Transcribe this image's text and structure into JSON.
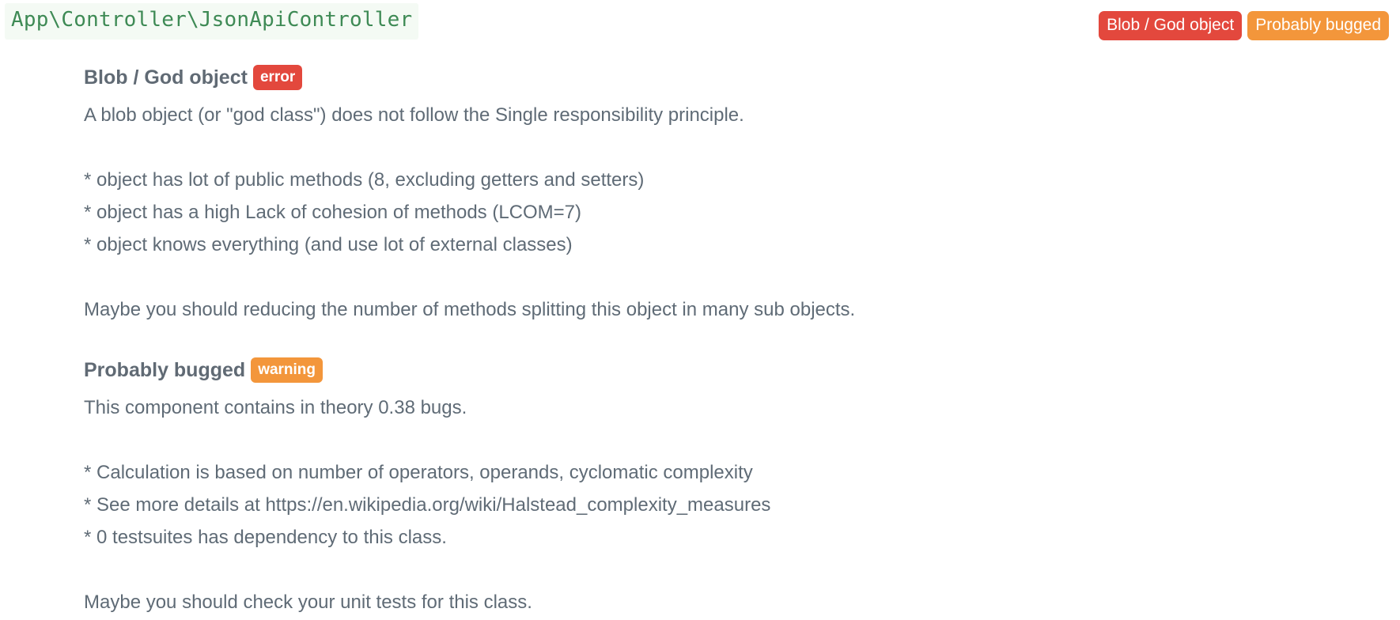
{
  "class_name": "App\\Controller\\JsonApiController",
  "header_badges": [
    {
      "label": "Blob / God object",
      "color": "#e3483d"
    },
    {
      "label": "Probably bugged",
      "color": "#f3963b"
    }
  ],
  "violations": [
    {
      "title": "Blob / God object",
      "level": "error",
      "level_color": "#e3483d",
      "lines": [
        "A blob object (or \"god class\") does not follow the Single responsibility principle.",
        "",
        "* object has lot of public methods (8, excluding getters and setters)",
        "* object has a high Lack of cohesion of methods (LCOM=7)",
        "* object knows everything (and use lot of external classes)",
        "",
        "Maybe you should reducing the number of methods splitting this object in many sub objects."
      ]
    },
    {
      "title": "Probably bugged",
      "level": "warning",
      "level_color": "#f3963b",
      "lines": [
        "This component contains in theory 0.38 bugs.",
        "",
        "* Calculation is based on number of operators, operands, cyclomatic complexity",
        "* See more details at https://en.wikipedia.org/wiki/Halstead_complexity_measures",
        "* 0 testsuites has dependency to this class.",
        "",
        "Maybe you should check your unit tests for this class."
      ]
    }
  ]
}
